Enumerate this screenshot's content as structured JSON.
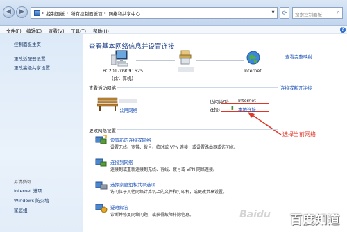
{
  "breadcrumb": [
    "控制面板",
    "所有控制面板项",
    "网络和共享中心"
  ],
  "search": {
    "placeholder": "搜索控制面板"
  },
  "menu": [
    "文件(F)",
    "编辑(E)",
    "查看(V)",
    "工具(T)",
    "帮助(H)"
  ],
  "sidebar": {
    "home": "控制面板主页",
    "links": [
      "更改适配器设置",
      "更改高级共享设置"
    ],
    "see_also_heading": "另请参阅",
    "see_also": [
      "Internet 选项",
      "Windows 防火墙",
      "家庭组"
    ]
  },
  "main": {
    "title": "查看基本网络信息并设置连接",
    "view_full_map": "查看完整映射",
    "computer_name": "PC201709091625",
    "computer_sub": "(此计算机)",
    "internet_label": "Internet",
    "active_heading": "查看活动网络",
    "connect_disconnect": "连接或断开连接",
    "network_type": "公用网络",
    "access_type_label": "访问类型:",
    "access_type_value": "Internet",
    "connection_label": "连接:",
    "connection_value": "本地连接",
    "change_heading": "更改网络设置",
    "tasks": [
      {
        "title": "设置新的连接或网络",
        "desc": "设置无线、宽带、拨号、临时或 VPN 连接；或设置路由器或访问点。"
      },
      {
        "title": "连接到网络",
        "desc": "连接到或重新连接到无线、有线、拨号或 VPN 网络连接。"
      },
      {
        "title": "选择家庭组和共享选项",
        "desc": "访问位于其他网络计算机上的文件和打印机，或更改共享设置。"
      },
      {
        "title": "疑难解答",
        "desc": "诊断并修复网络问题，或获得故障排除信息。"
      }
    ]
  },
  "annotation": "选择当前网络",
  "watermark": "百度知道",
  "colors": {
    "link": "#1f55b8",
    "title": "#1e3f8a",
    "annotation": "#e0362a"
  }
}
